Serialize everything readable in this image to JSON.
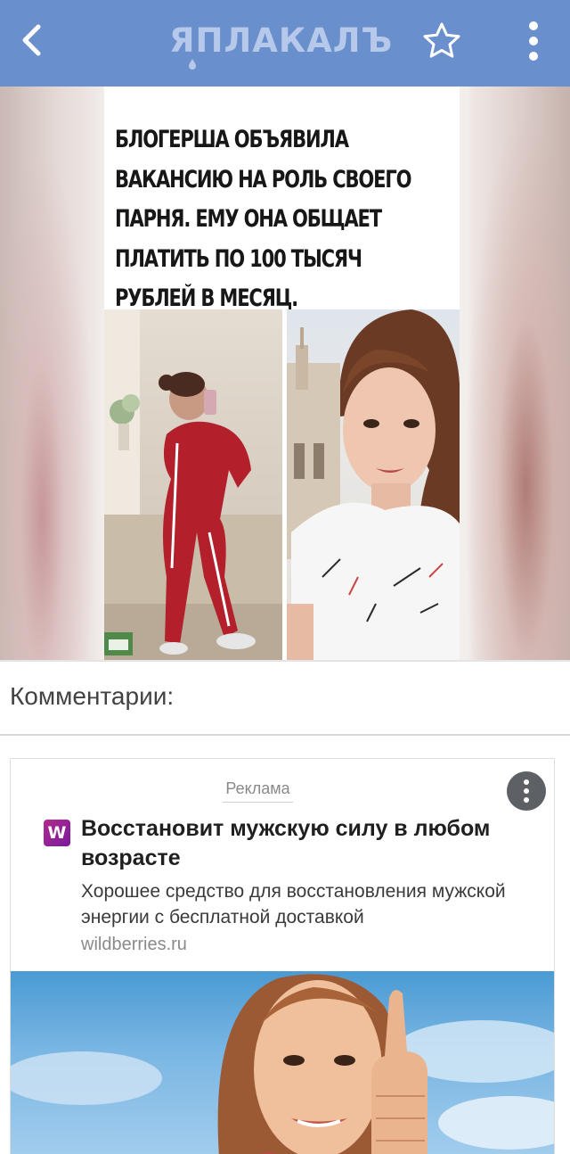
{
  "header": {
    "logo_text": "ЯПЛАКАЛЪ",
    "bar_color": "#6a8fcd",
    "back_icon": "chevron-left-icon",
    "favorite_icon": "star-outline-icon",
    "menu_icon": "more-vertical-icon"
  },
  "post": {
    "meme_caption": "БЛОГЕРША ОБЪЯВИЛА\nВАКАНСИЮ НА РОЛЬ СВОЕГО\nПАРНЯ. ЕМУ ОНА ОБЩАЕТ\nПЛАТИТЬ ПО 100 ТЫСЯЧ\nРУБЛЕЙ В МЕСЯЦ."
  },
  "comments": {
    "title": "Комментарии:"
  },
  "ad": {
    "label": "Реклама",
    "brand_letter": "W",
    "title": "Восстановит мужскую силу в любом возрасте",
    "description": "Хорошее средство для восстановления мужской энергии с бесплатной доставкой",
    "domain": "wildberries.ru",
    "brand_color": "#a0248f"
  }
}
